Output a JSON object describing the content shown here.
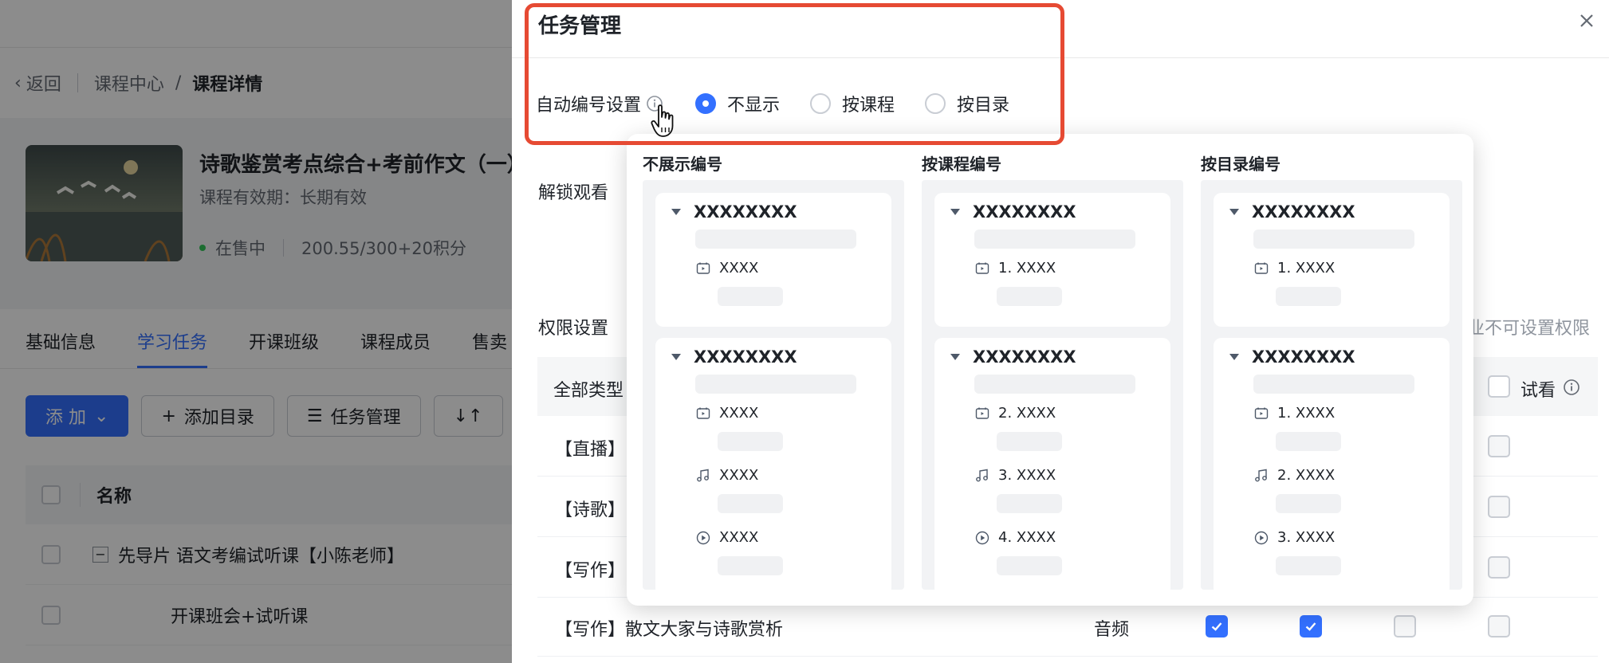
{
  "background": {
    "breadcrumb": {
      "back": "返回",
      "center": "课程中心",
      "separator": "/",
      "current": "课程详情"
    },
    "course": {
      "title": "诗歌鉴赏考点综合+考前作文（一）",
      "validity": "课程有效期：长期有效",
      "status": "在售中",
      "price": "200.55/300+20积分"
    },
    "tabs": [
      "基础信息",
      "学习任务",
      "开课班级",
      "课程成员",
      "售卖"
    ],
    "toolbar": {
      "add": "添 加",
      "add_dir": "添加目录",
      "task_manage": "任务管理",
      "sort": "↓↑"
    },
    "table": {
      "col_name": "名称",
      "rows": [
        "先导片 语文考编试听课【小陈老师】",
        "开课班会+试听课"
      ]
    }
  },
  "drawer": {
    "title": "任务管理",
    "numbering": {
      "label": "自动编号设置",
      "options": [
        "不显示",
        "按课程",
        "按目录"
      ],
      "selected": "不显示"
    },
    "unlock_label": "解锁观看",
    "perm_label": "权限设置",
    "perm_note": "业不可设置权限",
    "table": {
      "all_types": "全部类型",
      "trial": "试看",
      "rows": [
        {
          "name": "【直播】",
          "type": "",
          "c1": false,
          "c2": false,
          "c3": false,
          "c4": false
        },
        {
          "name": "【诗歌】",
          "type": "",
          "c1": false,
          "c2": false,
          "c3": false,
          "c4": false
        },
        {
          "name": "【写作】",
          "type": "",
          "c1": false,
          "c2": false,
          "c3": false,
          "c4": false
        },
        {
          "name": "【写作】散文大家与诗歌赏析",
          "type": "音频",
          "c1": true,
          "c2": true,
          "c3": false,
          "c4": false
        }
      ]
    }
  },
  "popover": {
    "columns": [
      {
        "title": "不展示编号",
        "cards": [
          {
            "header": "XXXXXXXX",
            "items": [
              {
                "icon": "live-icon",
                "label": "XXXX"
              }
            ]
          },
          {
            "header": "XXXXXXXX",
            "items": [
              {
                "icon": "live-icon",
                "label": "XXXX"
              },
              {
                "icon": "music-icon",
                "label": "XXXX"
              },
              {
                "icon": "play-icon",
                "label": "XXXX"
              }
            ]
          }
        ]
      },
      {
        "title": "按课程编号",
        "cards": [
          {
            "header": "XXXXXXXX",
            "items": [
              {
                "icon": "live-icon",
                "label": "1. XXXX"
              }
            ]
          },
          {
            "header": "XXXXXXXX",
            "items": [
              {
                "icon": "live-icon",
                "label": "2. XXXX"
              },
              {
                "icon": "music-icon",
                "label": "3. XXXX"
              },
              {
                "icon": "play-icon",
                "label": "4. XXXX"
              }
            ]
          }
        ]
      },
      {
        "title": "按目录编号",
        "cards": [
          {
            "header": "XXXXXXXX",
            "items": [
              {
                "icon": "live-icon",
                "label": "1. XXXX"
              }
            ]
          },
          {
            "header": "XXXXXXXX",
            "items": [
              {
                "icon": "live-icon",
                "label": "1. XXXX"
              },
              {
                "icon": "music-icon",
                "label": "2. XXXX"
              },
              {
                "icon": "play-icon",
                "label": "3. XXXX"
              }
            ]
          }
        ]
      }
    ]
  },
  "colors": {
    "accent": "#3370ff",
    "highlight": "#e64a33",
    "mask": "rgba(0,0,0,0.45)"
  }
}
